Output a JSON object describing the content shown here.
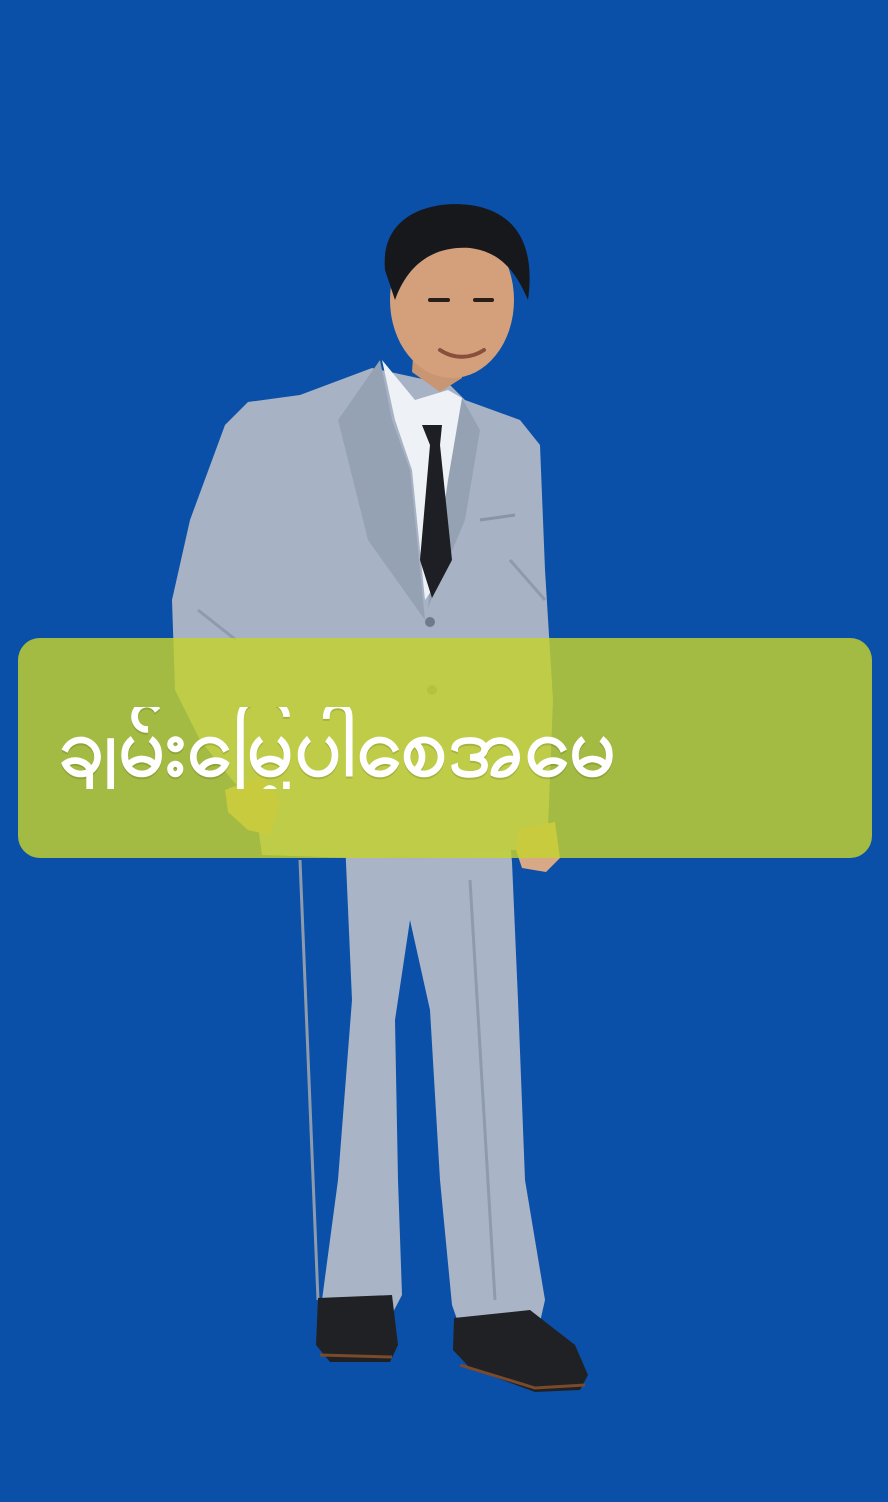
{
  "caption": {
    "text": "ချမ်းမြေ့ပါစေအမေ"
  },
  "colors": {
    "background": "#0b50a8",
    "banner": "#c4d22d",
    "caption_text": "#ffffff",
    "suit": "#a8b6c8",
    "tie": "#1d1f24",
    "shoes": "#202224"
  },
  "figure": {
    "subject": "smiling man in a grey suit with a white shirt and black tie, standing against a blue backdrop"
  }
}
